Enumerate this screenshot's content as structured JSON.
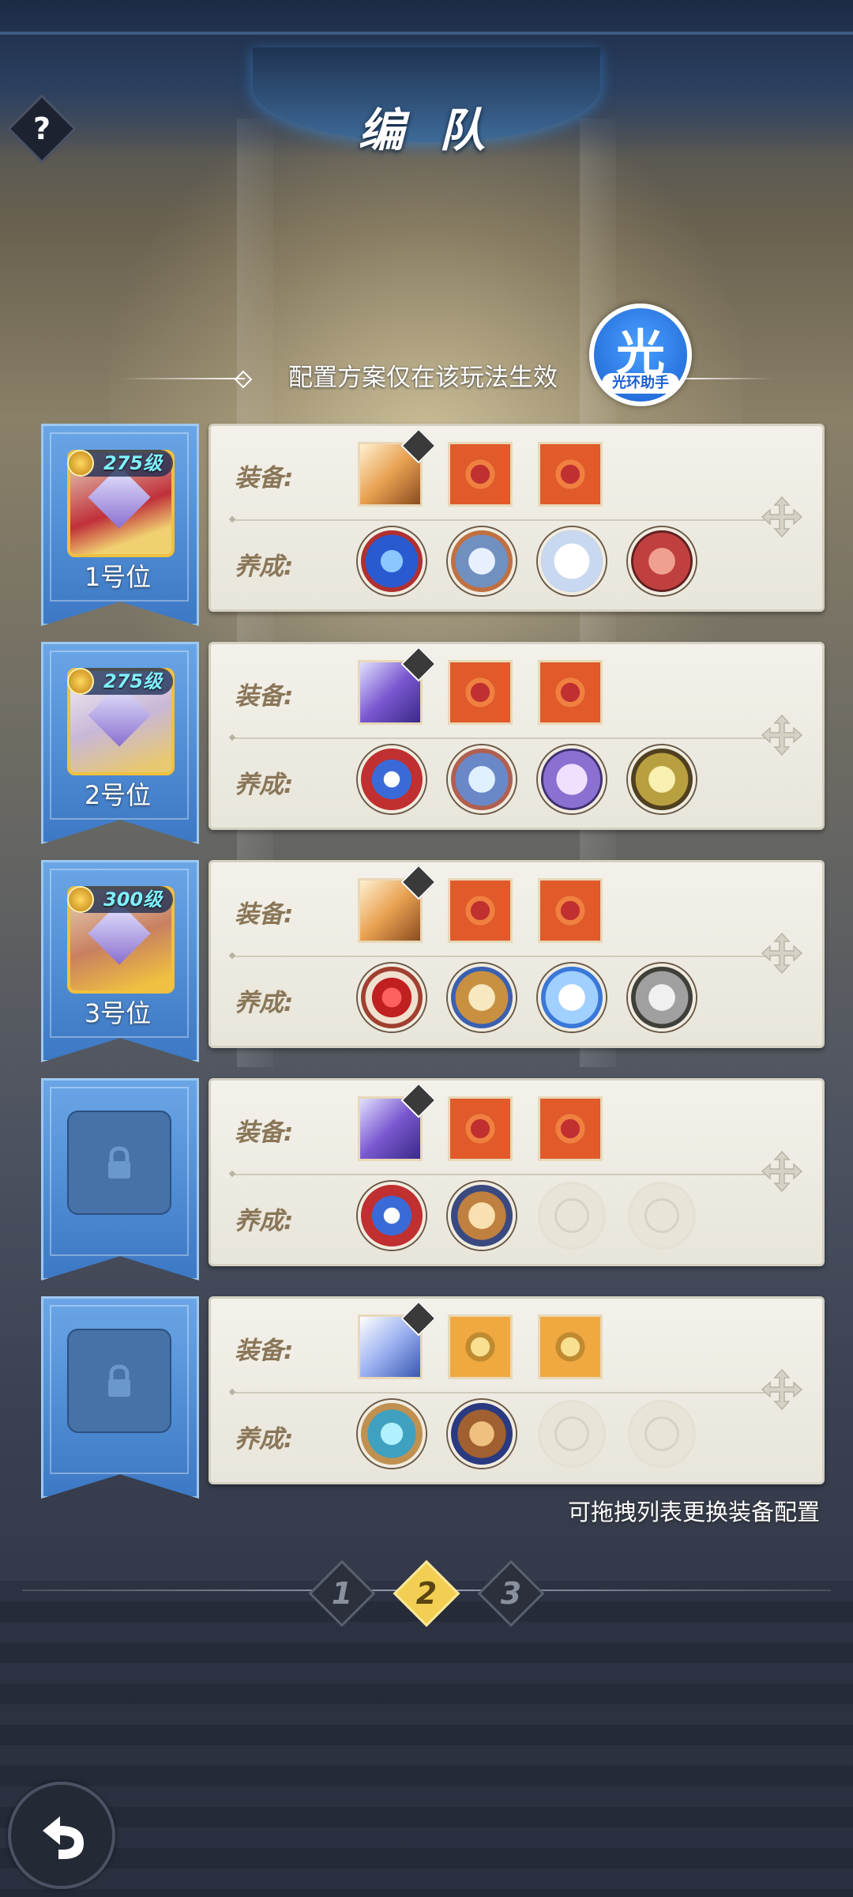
{
  "header": {
    "title": "编 队",
    "help_label": "?"
  },
  "notice": {
    "text": "配置方案仅在该玩法生效"
  },
  "assistant": {
    "char": "光",
    "label": "光环助手"
  },
  "labels": {
    "equip": "装备:",
    "cultivate": "养成:"
  },
  "slots": [
    {
      "position": "1号位",
      "level": "275级",
      "locked": false,
      "equipment": [
        "weapon-gold",
        "ring-red",
        "ring-red"
      ],
      "cultivation": [
        "blue-swirl-orb",
        "armor-orb",
        "cat-pet-orb",
        "helmet-orb"
      ]
    },
    {
      "position": "2号位",
      "level": "275级",
      "locked": false,
      "equipment": [
        "weapon-purple",
        "ring-red",
        "ring-red"
      ],
      "cultivation": [
        "swirl-orb",
        "mech-orb",
        "pet-orb",
        "mask-orb"
      ]
    },
    {
      "position": "3号位",
      "level": "300级",
      "locked": false,
      "equipment": [
        "weapon-gold",
        "ring-red",
        "ring-red"
      ],
      "cultivation": [
        "gem-orb",
        "shrine-orb",
        "spirit-pet-orb",
        "knight-helmet-orb"
      ]
    },
    {
      "position": "",
      "level": "",
      "locked": true,
      "equipment": [
        "weapon-purple",
        "ring-red",
        "ring-red"
      ],
      "cultivation": [
        "swirl-orb",
        "dragon-orb",
        "empty",
        "empty"
      ]
    },
    {
      "position": "",
      "level": "",
      "locked": true,
      "equipment": [
        "weapon-blue",
        "ring-gold",
        "ring-gold"
      ],
      "cultivation": [
        "rune-orb",
        "book-orb",
        "empty",
        "empty"
      ]
    }
  ],
  "tip": {
    "text": "可拖拽列表更换装备配置"
  },
  "pagination": {
    "pages": [
      "1",
      "2",
      "3"
    ],
    "active": "2"
  },
  "colors": {
    "banner": "#4a86d0",
    "active_page": "#f2cf52",
    "panel": "#f1efe8",
    "label": "#8a7658"
  }
}
